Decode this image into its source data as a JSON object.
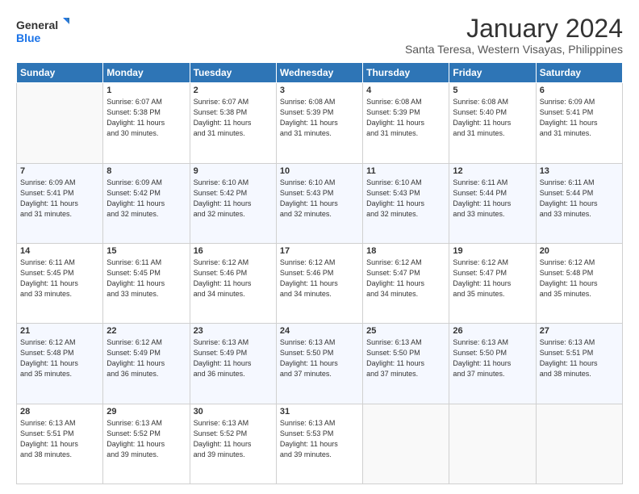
{
  "logo": {
    "general": "General",
    "blue": "Blue"
  },
  "title": "January 2024",
  "location": "Santa Teresa, Western Visayas, Philippines",
  "days_header": [
    "Sunday",
    "Monday",
    "Tuesday",
    "Wednesday",
    "Thursday",
    "Friday",
    "Saturday"
  ],
  "weeks": [
    [
      {
        "day": "",
        "content": ""
      },
      {
        "day": "1",
        "content": "Sunrise: 6:07 AM\nSunset: 5:38 PM\nDaylight: 11 hours\nand 30 minutes."
      },
      {
        "day": "2",
        "content": "Sunrise: 6:07 AM\nSunset: 5:38 PM\nDaylight: 11 hours\nand 31 minutes."
      },
      {
        "day": "3",
        "content": "Sunrise: 6:08 AM\nSunset: 5:39 PM\nDaylight: 11 hours\nand 31 minutes."
      },
      {
        "day": "4",
        "content": "Sunrise: 6:08 AM\nSunset: 5:39 PM\nDaylight: 11 hours\nand 31 minutes."
      },
      {
        "day": "5",
        "content": "Sunrise: 6:08 AM\nSunset: 5:40 PM\nDaylight: 11 hours\nand 31 minutes."
      },
      {
        "day": "6",
        "content": "Sunrise: 6:09 AM\nSunset: 5:41 PM\nDaylight: 11 hours\nand 31 minutes."
      }
    ],
    [
      {
        "day": "7",
        "content": "Sunrise: 6:09 AM\nSunset: 5:41 PM\nDaylight: 11 hours\nand 31 minutes."
      },
      {
        "day": "8",
        "content": "Sunrise: 6:09 AM\nSunset: 5:42 PM\nDaylight: 11 hours\nand 32 minutes."
      },
      {
        "day": "9",
        "content": "Sunrise: 6:10 AM\nSunset: 5:42 PM\nDaylight: 11 hours\nand 32 minutes."
      },
      {
        "day": "10",
        "content": "Sunrise: 6:10 AM\nSunset: 5:43 PM\nDaylight: 11 hours\nand 32 minutes."
      },
      {
        "day": "11",
        "content": "Sunrise: 6:10 AM\nSunset: 5:43 PM\nDaylight: 11 hours\nand 32 minutes."
      },
      {
        "day": "12",
        "content": "Sunrise: 6:11 AM\nSunset: 5:44 PM\nDaylight: 11 hours\nand 33 minutes."
      },
      {
        "day": "13",
        "content": "Sunrise: 6:11 AM\nSunset: 5:44 PM\nDaylight: 11 hours\nand 33 minutes."
      }
    ],
    [
      {
        "day": "14",
        "content": "Sunrise: 6:11 AM\nSunset: 5:45 PM\nDaylight: 11 hours\nand 33 minutes."
      },
      {
        "day": "15",
        "content": "Sunrise: 6:11 AM\nSunset: 5:45 PM\nDaylight: 11 hours\nand 33 minutes."
      },
      {
        "day": "16",
        "content": "Sunrise: 6:12 AM\nSunset: 5:46 PM\nDaylight: 11 hours\nand 34 minutes."
      },
      {
        "day": "17",
        "content": "Sunrise: 6:12 AM\nSunset: 5:46 PM\nDaylight: 11 hours\nand 34 minutes."
      },
      {
        "day": "18",
        "content": "Sunrise: 6:12 AM\nSunset: 5:47 PM\nDaylight: 11 hours\nand 34 minutes."
      },
      {
        "day": "19",
        "content": "Sunrise: 6:12 AM\nSunset: 5:47 PM\nDaylight: 11 hours\nand 35 minutes."
      },
      {
        "day": "20",
        "content": "Sunrise: 6:12 AM\nSunset: 5:48 PM\nDaylight: 11 hours\nand 35 minutes."
      }
    ],
    [
      {
        "day": "21",
        "content": "Sunrise: 6:12 AM\nSunset: 5:48 PM\nDaylight: 11 hours\nand 35 minutes."
      },
      {
        "day": "22",
        "content": "Sunrise: 6:12 AM\nSunset: 5:49 PM\nDaylight: 11 hours\nand 36 minutes."
      },
      {
        "day": "23",
        "content": "Sunrise: 6:13 AM\nSunset: 5:49 PM\nDaylight: 11 hours\nand 36 minutes."
      },
      {
        "day": "24",
        "content": "Sunrise: 6:13 AM\nSunset: 5:50 PM\nDaylight: 11 hours\nand 37 minutes."
      },
      {
        "day": "25",
        "content": "Sunrise: 6:13 AM\nSunset: 5:50 PM\nDaylight: 11 hours\nand 37 minutes."
      },
      {
        "day": "26",
        "content": "Sunrise: 6:13 AM\nSunset: 5:50 PM\nDaylight: 11 hours\nand 37 minutes."
      },
      {
        "day": "27",
        "content": "Sunrise: 6:13 AM\nSunset: 5:51 PM\nDaylight: 11 hours\nand 38 minutes."
      }
    ],
    [
      {
        "day": "28",
        "content": "Sunrise: 6:13 AM\nSunset: 5:51 PM\nDaylight: 11 hours\nand 38 minutes."
      },
      {
        "day": "29",
        "content": "Sunrise: 6:13 AM\nSunset: 5:52 PM\nDaylight: 11 hours\nand 39 minutes."
      },
      {
        "day": "30",
        "content": "Sunrise: 6:13 AM\nSunset: 5:52 PM\nDaylight: 11 hours\nand 39 minutes."
      },
      {
        "day": "31",
        "content": "Sunrise: 6:13 AM\nSunset: 5:53 PM\nDaylight: 11 hours\nand 39 minutes."
      },
      {
        "day": "",
        "content": ""
      },
      {
        "day": "",
        "content": ""
      },
      {
        "day": "",
        "content": ""
      }
    ]
  ]
}
